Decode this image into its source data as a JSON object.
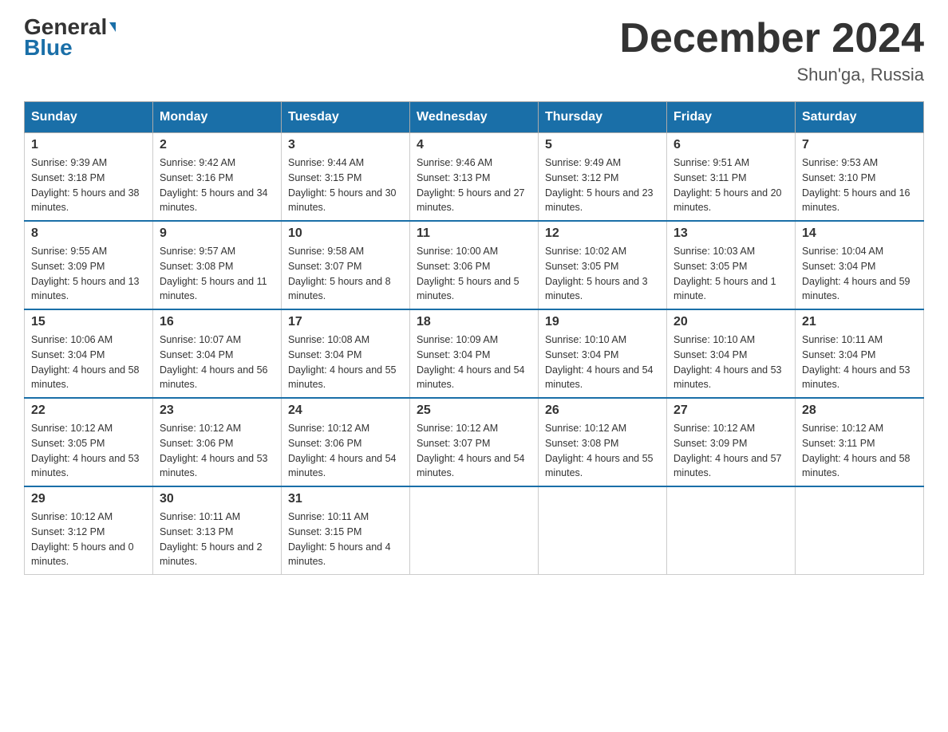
{
  "header": {
    "logo_general": "General",
    "logo_blue": "Blue",
    "month_title": "December 2024",
    "location": "Shun'ga, Russia"
  },
  "days_of_week": [
    "Sunday",
    "Monday",
    "Tuesday",
    "Wednesday",
    "Thursday",
    "Friday",
    "Saturday"
  ],
  "weeks": [
    [
      {
        "day": "1",
        "sunrise": "Sunrise: 9:39 AM",
        "sunset": "Sunset: 3:18 PM",
        "daylight": "Daylight: 5 hours and 38 minutes."
      },
      {
        "day": "2",
        "sunrise": "Sunrise: 9:42 AM",
        "sunset": "Sunset: 3:16 PM",
        "daylight": "Daylight: 5 hours and 34 minutes."
      },
      {
        "day": "3",
        "sunrise": "Sunrise: 9:44 AM",
        "sunset": "Sunset: 3:15 PM",
        "daylight": "Daylight: 5 hours and 30 minutes."
      },
      {
        "day": "4",
        "sunrise": "Sunrise: 9:46 AM",
        "sunset": "Sunset: 3:13 PM",
        "daylight": "Daylight: 5 hours and 27 minutes."
      },
      {
        "day": "5",
        "sunrise": "Sunrise: 9:49 AM",
        "sunset": "Sunset: 3:12 PM",
        "daylight": "Daylight: 5 hours and 23 minutes."
      },
      {
        "day": "6",
        "sunrise": "Sunrise: 9:51 AM",
        "sunset": "Sunset: 3:11 PM",
        "daylight": "Daylight: 5 hours and 20 minutes."
      },
      {
        "day": "7",
        "sunrise": "Sunrise: 9:53 AM",
        "sunset": "Sunset: 3:10 PM",
        "daylight": "Daylight: 5 hours and 16 minutes."
      }
    ],
    [
      {
        "day": "8",
        "sunrise": "Sunrise: 9:55 AM",
        "sunset": "Sunset: 3:09 PM",
        "daylight": "Daylight: 5 hours and 13 minutes."
      },
      {
        "day": "9",
        "sunrise": "Sunrise: 9:57 AM",
        "sunset": "Sunset: 3:08 PM",
        "daylight": "Daylight: 5 hours and 11 minutes."
      },
      {
        "day": "10",
        "sunrise": "Sunrise: 9:58 AM",
        "sunset": "Sunset: 3:07 PM",
        "daylight": "Daylight: 5 hours and 8 minutes."
      },
      {
        "day": "11",
        "sunrise": "Sunrise: 10:00 AM",
        "sunset": "Sunset: 3:06 PM",
        "daylight": "Daylight: 5 hours and 5 minutes."
      },
      {
        "day": "12",
        "sunrise": "Sunrise: 10:02 AM",
        "sunset": "Sunset: 3:05 PM",
        "daylight": "Daylight: 5 hours and 3 minutes."
      },
      {
        "day": "13",
        "sunrise": "Sunrise: 10:03 AM",
        "sunset": "Sunset: 3:05 PM",
        "daylight": "Daylight: 5 hours and 1 minute."
      },
      {
        "day": "14",
        "sunrise": "Sunrise: 10:04 AM",
        "sunset": "Sunset: 3:04 PM",
        "daylight": "Daylight: 4 hours and 59 minutes."
      }
    ],
    [
      {
        "day": "15",
        "sunrise": "Sunrise: 10:06 AM",
        "sunset": "Sunset: 3:04 PM",
        "daylight": "Daylight: 4 hours and 58 minutes."
      },
      {
        "day": "16",
        "sunrise": "Sunrise: 10:07 AM",
        "sunset": "Sunset: 3:04 PM",
        "daylight": "Daylight: 4 hours and 56 minutes."
      },
      {
        "day": "17",
        "sunrise": "Sunrise: 10:08 AM",
        "sunset": "Sunset: 3:04 PM",
        "daylight": "Daylight: 4 hours and 55 minutes."
      },
      {
        "day": "18",
        "sunrise": "Sunrise: 10:09 AM",
        "sunset": "Sunset: 3:04 PM",
        "daylight": "Daylight: 4 hours and 54 minutes."
      },
      {
        "day": "19",
        "sunrise": "Sunrise: 10:10 AM",
        "sunset": "Sunset: 3:04 PM",
        "daylight": "Daylight: 4 hours and 54 minutes."
      },
      {
        "day": "20",
        "sunrise": "Sunrise: 10:10 AM",
        "sunset": "Sunset: 3:04 PM",
        "daylight": "Daylight: 4 hours and 53 minutes."
      },
      {
        "day": "21",
        "sunrise": "Sunrise: 10:11 AM",
        "sunset": "Sunset: 3:04 PM",
        "daylight": "Daylight: 4 hours and 53 minutes."
      }
    ],
    [
      {
        "day": "22",
        "sunrise": "Sunrise: 10:12 AM",
        "sunset": "Sunset: 3:05 PM",
        "daylight": "Daylight: 4 hours and 53 minutes."
      },
      {
        "day": "23",
        "sunrise": "Sunrise: 10:12 AM",
        "sunset": "Sunset: 3:06 PM",
        "daylight": "Daylight: 4 hours and 53 minutes."
      },
      {
        "day": "24",
        "sunrise": "Sunrise: 10:12 AM",
        "sunset": "Sunset: 3:06 PM",
        "daylight": "Daylight: 4 hours and 54 minutes."
      },
      {
        "day": "25",
        "sunrise": "Sunrise: 10:12 AM",
        "sunset": "Sunset: 3:07 PM",
        "daylight": "Daylight: 4 hours and 54 minutes."
      },
      {
        "day": "26",
        "sunrise": "Sunrise: 10:12 AM",
        "sunset": "Sunset: 3:08 PM",
        "daylight": "Daylight: 4 hours and 55 minutes."
      },
      {
        "day": "27",
        "sunrise": "Sunrise: 10:12 AM",
        "sunset": "Sunset: 3:09 PM",
        "daylight": "Daylight: 4 hours and 57 minutes."
      },
      {
        "day": "28",
        "sunrise": "Sunrise: 10:12 AM",
        "sunset": "Sunset: 3:11 PM",
        "daylight": "Daylight: 4 hours and 58 minutes."
      }
    ],
    [
      {
        "day": "29",
        "sunrise": "Sunrise: 10:12 AM",
        "sunset": "Sunset: 3:12 PM",
        "daylight": "Daylight: 5 hours and 0 minutes."
      },
      {
        "day": "30",
        "sunrise": "Sunrise: 10:11 AM",
        "sunset": "Sunset: 3:13 PM",
        "daylight": "Daylight: 5 hours and 2 minutes."
      },
      {
        "day": "31",
        "sunrise": "Sunrise: 10:11 AM",
        "sunset": "Sunset: 3:15 PM",
        "daylight": "Daylight: 5 hours and 4 minutes."
      },
      null,
      null,
      null,
      null
    ]
  ]
}
